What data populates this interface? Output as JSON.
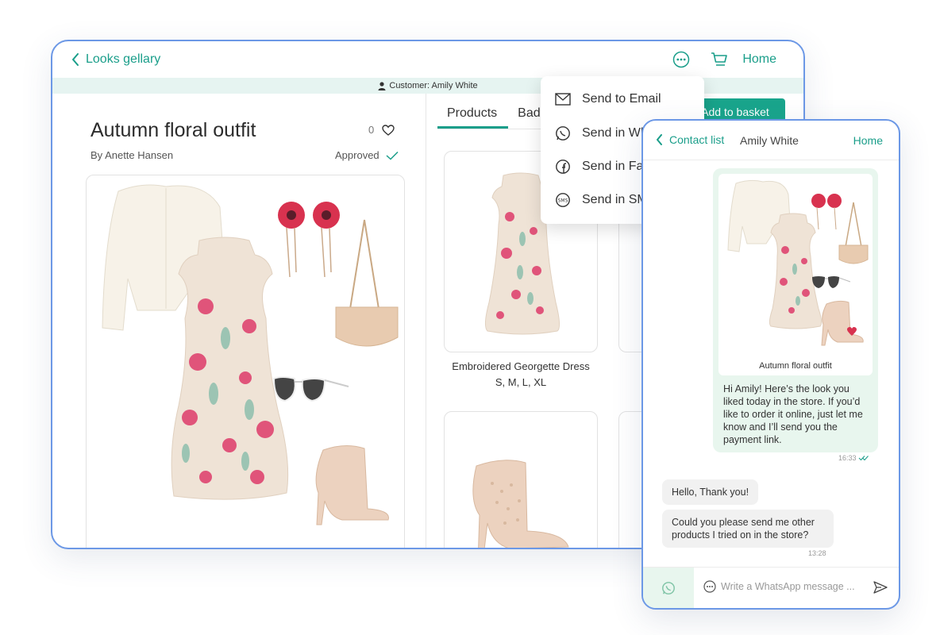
{
  "tablet": {
    "back_label": "Looks gellary",
    "home_label": "Home",
    "customer_bar": "Customer: Amily White",
    "look": {
      "title": "Autumn floral outfit",
      "author": "By Anette Hansen",
      "likes": "0",
      "status": "Approved"
    },
    "tabs": [
      {
        "label": "Products"
      },
      {
        "label": "Bad"
      }
    ],
    "add_to_basket": "Add to basket",
    "products": [
      {
        "name": "Embroidered Georgette Dress",
        "sizes": "S, M, L, XL"
      }
    ],
    "share_menu": [
      {
        "label": "Send to Email",
        "icon": "mail-icon"
      },
      {
        "label": "Send in WhatsApp",
        "icon": "whatsapp-icon"
      },
      {
        "label": "Send in Facebook",
        "icon": "facebook-icon"
      },
      {
        "label": "Send in SMS",
        "icon": "sms-icon"
      }
    ]
  },
  "phone": {
    "back_label": "Contact list",
    "contact_name": "Amily White",
    "home_label": "Home",
    "outgoing": {
      "image_caption": "Autumn floral outfit",
      "text": "Hi Amily! Here’s the look you liked today in the store. If you’d like to order it online, just let me know and I’ll send you the payment link.",
      "time": "16:33"
    },
    "incoming": [
      {
        "text": "Hello, Thank you!"
      },
      {
        "text": "Could you please send me other products I tried on in the store?"
      }
    ],
    "incoming_time": "13:28",
    "input_placeholder": "Write a WhatsApp message ..."
  },
  "colors": {
    "accent": "#1a9e8a",
    "frame": "#6c98e6",
    "customer_bar_bg": "#e6f4f1",
    "button_bg": "#19a58c",
    "outgoing_bubble": "#e8f6ee",
    "incoming_bubble": "#f1f1f1"
  }
}
